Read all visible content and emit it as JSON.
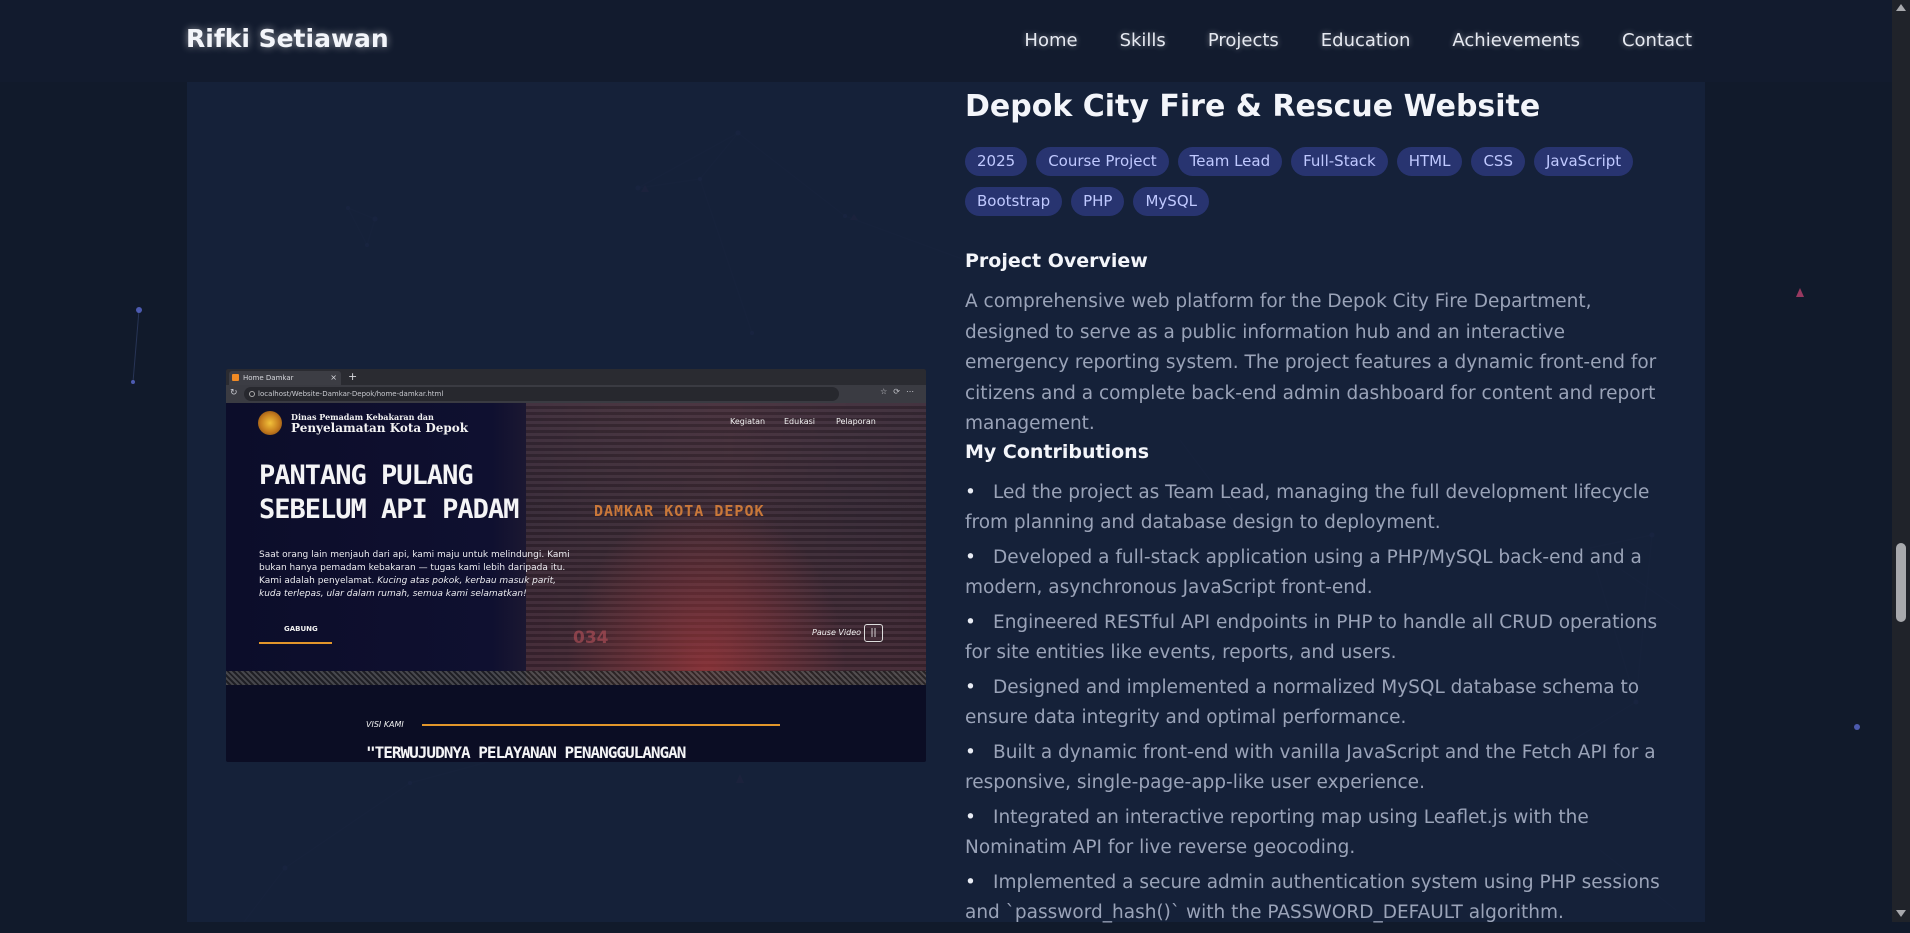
{
  "site": {
    "brand": "Rifki Setiawan"
  },
  "nav": {
    "items": [
      "Home",
      "Skills",
      "Projects",
      "Education",
      "Achievements",
      "Contact"
    ]
  },
  "project": {
    "title": "Depok City Fire & Rescue Website",
    "tags": [
      "2025",
      "Course Project",
      "Team Lead",
      "Full-Stack",
      "HTML",
      "CSS",
      "JavaScript",
      "Bootstrap",
      "PHP",
      "MySQL"
    ],
    "overview_heading": "Project Overview",
    "overview": "A comprehensive web platform for the Depok City Fire Department, designed to serve as a public information hub and an interactive emergency reporting system. The project features a dynamic front-end for citizens and a complete back-end admin dashboard for content and report management.",
    "contributions_heading": "My Contributions",
    "contributions": [
      "Led the project as Team Lead, managing the full development lifecycle from planning and database design to deployment.",
      "Developed a full-stack application using a PHP/MySQL back-end and a modern, asynchronous JavaScript front-end.",
      "Engineered RESTful API endpoints in PHP to handle all CRUD operations for site entities like events, reports, and users.",
      "Designed and implemented a normalized MySQL database schema to ensure data integrity and optimal performance.",
      "Built a dynamic front-end with vanilla JavaScript and the Fetch API for a responsive, single-page-app-like user experience.",
      "Integrated an interactive reporting map using Leaflet.js with the Nominatim API for live reverse geocoding.",
      "Implemented a secure admin authentication system using PHP sessions and `password_hash()` with the PASSWORD_DEFAULT algorithm."
    ]
  },
  "screenshot": {
    "tab_title": "Home Damkar",
    "url": "localhost/Website-Damkar-Depok/home-damkar.html",
    "org_line1": "Dinas Pemadam Kebakaran dan",
    "org_line2": "Penyelamatan Kota Depok",
    "nav": [
      "Kegiatan",
      "Edukasi",
      "Pelaporan"
    ],
    "hero_title_line1": "PANTANG PULANG",
    "hero_title_line2": "SEBELUM API PADAM",
    "hero_desc": "Saat orang lain menjauh dari api, kami maju untuk melindungi. Kami bukan hanya pemadam kebakaran — tugas kami lebih daripada itu. Kami adalah penyelamat.",
    "hero_desc_italic": "Kucing atas pokok, kerbau masuk parit, kuda terlepas, ular dalam rumah, semua kami selamatkan!",
    "join_label": "GABUNG",
    "truck_label": "DAMKAR KOTA DEPOK",
    "truck_number": "034",
    "pause_label": "Pause Video",
    "visi_label": "VISI KAMI",
    "visi_quote": "\"TERWUJUDNYA PELAYANAN PENANGGULANGAN"
  },
  "colors": {
    "background": "#111a2b",
    "panel": "#16213a",
    "tag_bg": "#283470",
    "tag_text": "#c0c9ff",
    "accent": "#e2962b"
  }
}
